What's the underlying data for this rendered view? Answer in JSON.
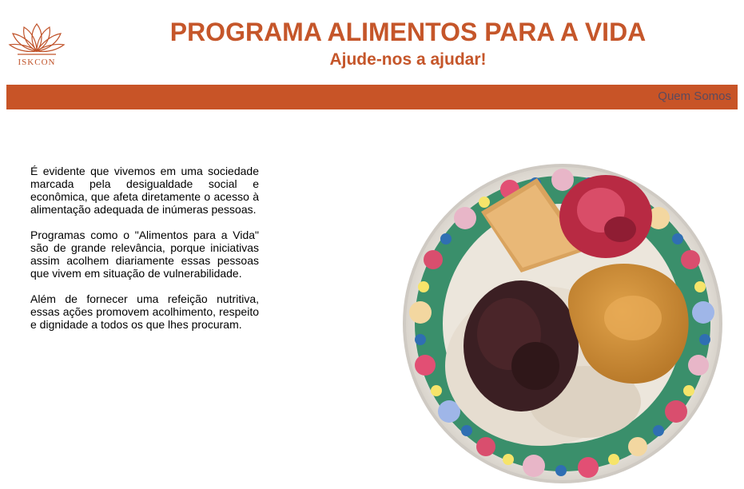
{
  "header": {
    "logo_text": "ISKCON",
    "title": "PROGRAMA ALIMENTOS PARA A VIDA",
    "subtitle": "Ajude-nos a ajudar!"
  },
  "nav": {
    "items": [
      {
        "label": "Quem Somos"
      }
    ]
  },
  "main": {
    "paragraphs": [
      "É evidente que vivemos em uma sociedade marcada pela desigualdade social e econômica, que afeta diretamente o acesso à alimentação adequada de inúmeras pessoas.",
      "Programas como o \"Alimentos para a Vida\" são de grande relevância, porque iniciativas assim acolhem diariamente essas pessoas que vivem em situação de vulnerabilidade.",
      "Além de fornecer uma refeição nutritiva, essas ações promovem acolhimento, respeito e dignidade a todos os que lhes procuram."
    ]
  },
  "colors": {
    "brand": "#c85427",
    "nav_link": "#5b4a5e"
  },
  "icons": {
    "logo": "lotus-icon",
    "photo": "plate-of-food-image"
  }
}
